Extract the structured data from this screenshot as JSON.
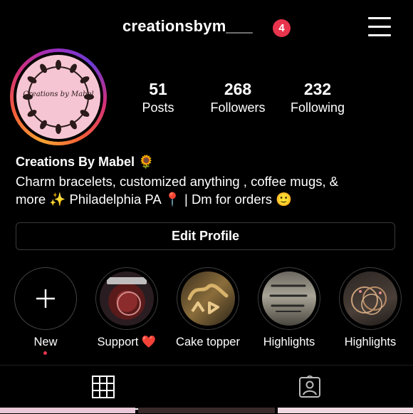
{
  "header": {
    "username": "creationsbym___",
    "notification_count": "4"
  },
  "profile": {
    "avatar_text": "Creations by Mabel",
    "stats": [
      {
        "value": "51",
        "label": "Posts"
      },
      {
        "value": "268",
        "label": "Followers"
      },
      {
        "value": "232",
        "label": "Following"
      }
    ],
    "name": "Creations By Mabel 🌻",
    "bio_line1": "Charm bracelets, customized anything , coffee mugs, &",
    "bio_line2": "more ✨ Philadelphia PA 📍 | Dm for orders 🙂",
    "edit_button": "Edit Profile"
  },
  "highlights": [
    {
      "label": "New"
    },
    {
      "label": "Support ❤️"
    },
    {
      "label": "Cake topper"
    },
    {
      "label": "Highlights"
    },
    {
      "label": "Highlights"
    }
  ],
  "tabs": {
    "active": "grid-icon",
    "items": [
      "grid-icon",
      "tagged-icon"
    ]
  },
  "colors": {
    "background": "#000000",
    "badge": "#e8344d",
    "avatar_bg": "#f6c5d3"
  }
}
